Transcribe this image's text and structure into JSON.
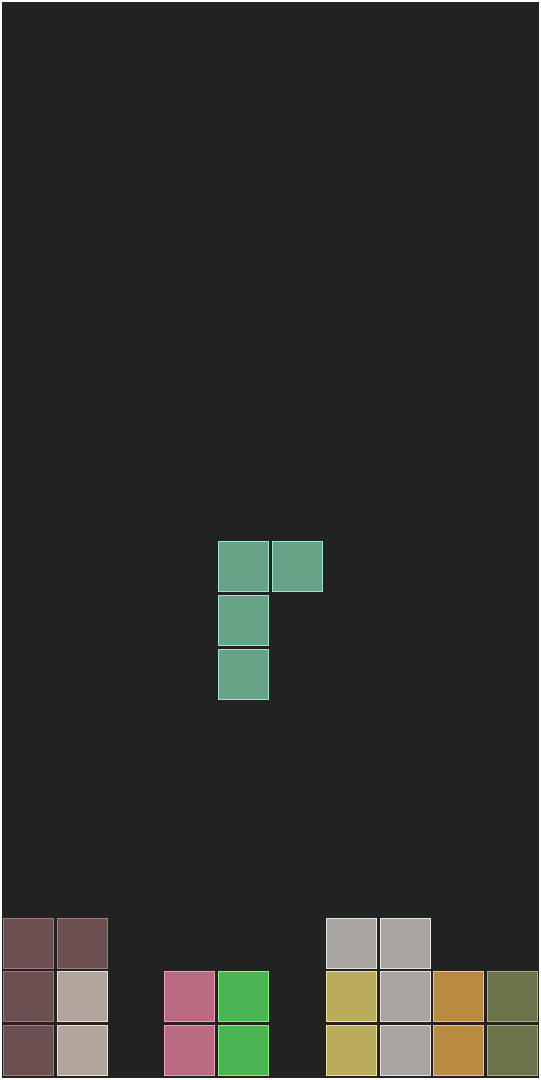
{
  "game": {
    "title": "",
    "columns": 10,
    "rows": 20
  },
  "colors": {
    "board_background": "#222222",
    "active_piece_fill": "#66a387",
    "active_piece_border": "#9fe5cc"
  },
  "active_piece": {
    "type": "J",
    "cells": [
      {
        "col": 4,
        "row": 10
      },
      {
        "col": 5,
        "row": 10
      },
      {
        "col": 4,
        "row": 11
      },
      {
        "col": 4,
        "row": 12
      }
    ]
  },
  "locked_cells": [
    {
      "col": 0,
      "row": 17,
      "color": "#6c5051",
      "border": "#a57b7d"
    },
    {
      "col": 1,
      "row": 17,
      "color": "#6c5051",
      "border": "#a57b7d"
    },
    {
      "col": 0,
      "row": 18,
      "color": "#6c5051",
      "border": "#a57b7d"
    },
    {
      "col": 0,
      "row": 19,
      "color": "#6c5051",
      "border": "#a57b7d"
    },
    {
      "col": 1,
      "row": 18,
      "color": "#b3a59c",
      "border": "#ece2dc"
    },
    {
      "col": 1,
      "row": 19,
      "color": "#b3a59c",
      "border": "#ece2dc"
    },
    {
      "col": 3,
      "row": 18,
      "color": "#b86a80",
      "border": "#f0a0b8"
    },
    {
      "col": 3,
      "row": 19,
      "color": "#b86a80",
      "border": "#f0a0b8"
    },
    {
      "col": 4,
      "row": 18,
      "color": "#4bb551",
      "border": "#8af08f"
    },
    {
      "col": 4,
      "row": 19,
      "color": "#4bb551",
      "border": "#8af08f"
    },
    {
      "col": 6,
      "row": 17,
      "color": "#a8a4a0",
      "border": "#e6e3e0"
    },
    {
      "col": 7,
      "row": 17,
      "color": "#a8a4a0",
      "border": "#e6e3e0"
    },
    {
      "col": 7,
      "row": 18,
      "color": "#a8a4a0",
      "border": "#e6e3e0"
    },
    {
      "col": 7,
      "row": 19,
      "color": "#a8a4a0",
      "border": "#e6e3e0"
    },
    {
      "col": 6,
      "row": 18,
      "color": "#b9ad5b",
      "border": "#efe395"
    },
    {
      "col": 6,
      "row": 19,
      "color": "#b9ad5b",
      "border": "#efe395"
    },
    {
      "col": 8,
      "row": 18,
      "color": "#b98b43",
      "border": "#efc57e"
    },
    {
      "col": 8,
      "row": 19,
      "color": "#b98b43",
      "border": "#efc57e"
    },
    {
      "col": 9,
      "row": 18,
      "color": "#6b734a",
      "border": "#a8b27a"
    },
    {
      "col": 9,
      "row": 19,
      "color": "#6b734a",
      "border": "#a8b27a"
    }
  ]
}
